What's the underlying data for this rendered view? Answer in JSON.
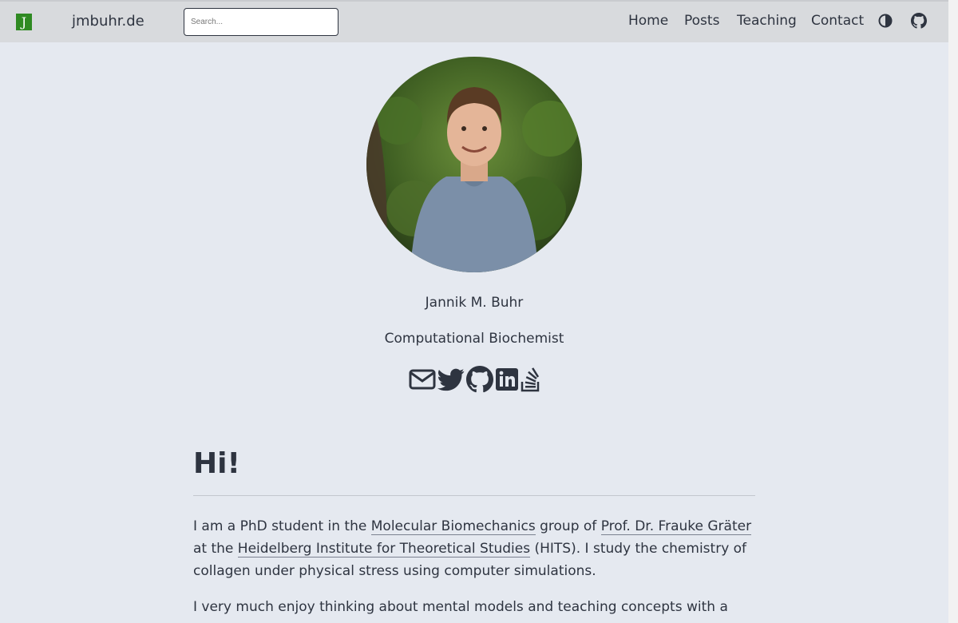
{
  "navbar": {
    "logo_letter": "J",
    "brand": "jmbuhr.de",
    "search_placeholder": "Search...",
    "links": [
      "Home",
      "Posts",
      "Teaching",
      "Contact"
    ],
    "icons": [
      "theme-toggle-icon",
      "github-icon"
    ]
  },
  "profile": {
    "name": "Jannik M. Buhr",
    "role": "Computational Biochemist",
    "social_icons": [
      "email-icon",
      "twitter-icon",
      "github-icon",
      "linkedin-icon",
      "stackoverflow-icon"
    ]
  },
  "content": {
    "heading": "Hi!",
    "p1": {
      "t1": "I am a PhD student in the ",
      "link1": "Molecular Biomechanics",
      "t2": " group of ",
      "link2": "Prof. Dr. Frauke Gräter",
      "t3": " at the ",
      "link3": "Heidelberg Institute for Theoretical Studies",
      "t4": " (HITS). I study the chemistry of collagen under physical stress using computer simulations."
    },
    "p2": "I very much enjoy thinking about mental models and teaching concepts with a focus on"
  },
  "colors": {
    "page_bg": "#e5e9f0",
    "navbar_bg": "#d8dadd",
    "text": "#2e3440",
    "logo_bg": "#2f8a22"
  }
}
